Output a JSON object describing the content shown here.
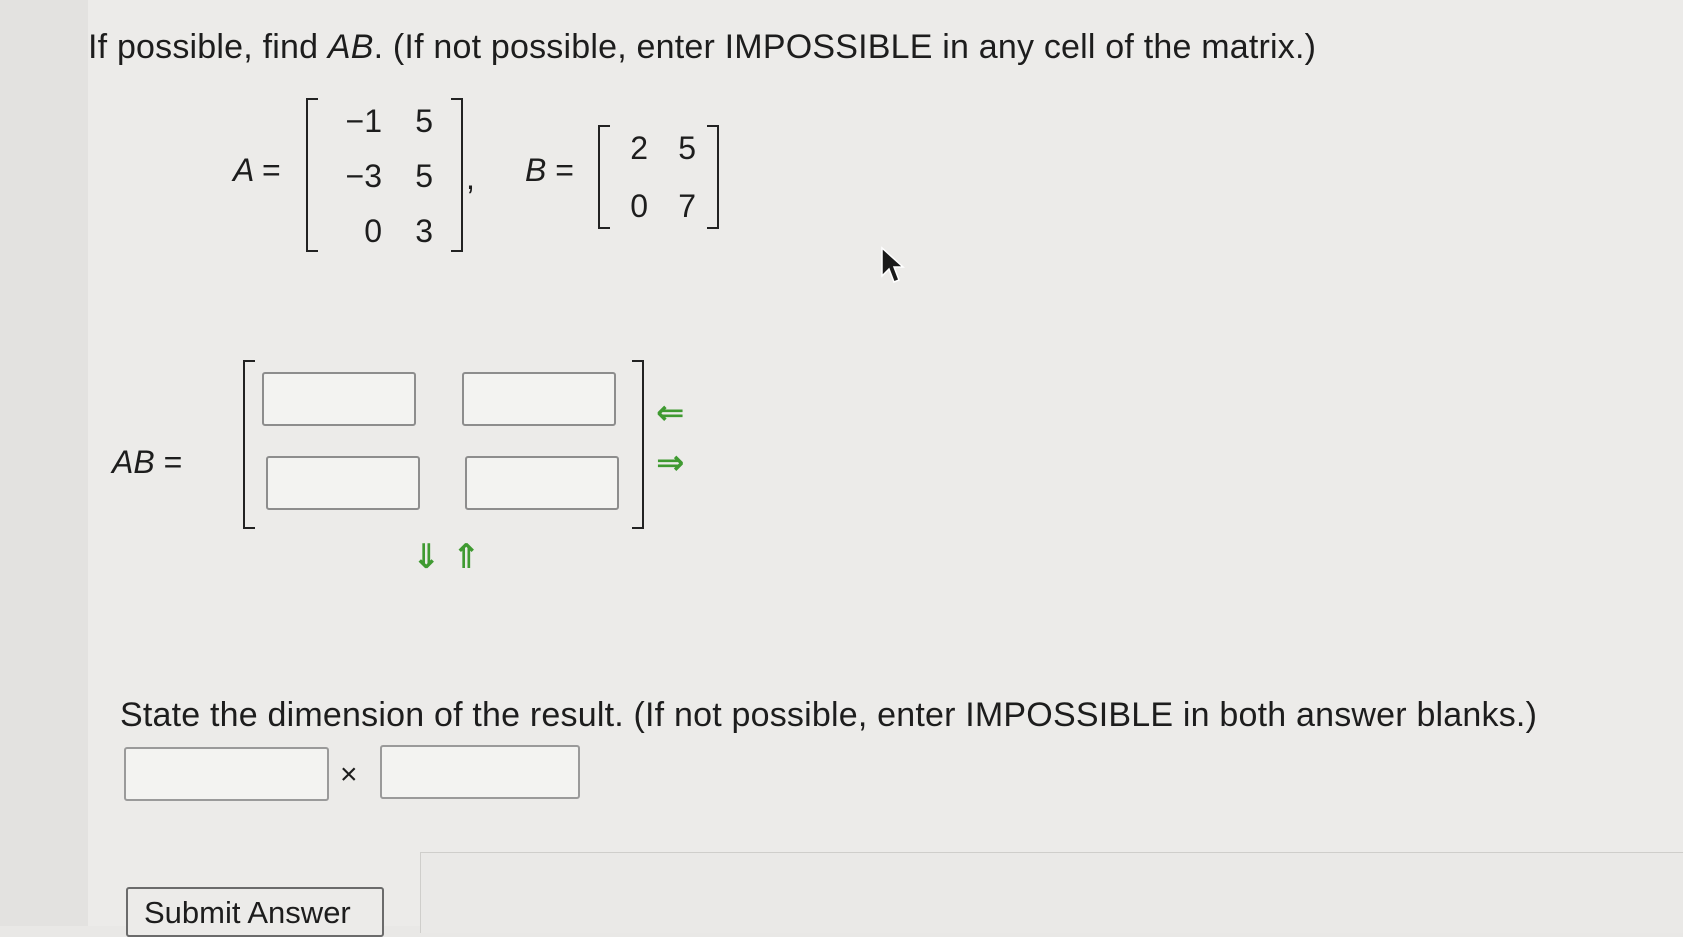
{
  "question": {
    "instruction_prefix": "If possible, find ",
    "instruction_var": "AB",
    "instruction_suffix": ". (If not possible, enter IMPOSSIBLE in any cell of the matrix.)"
  },
  "matrix_a": {
    "label": "A",
    "rows": [
      [
        "−1",
        "5"
      ],
      [
        "−3",
        "5"
      ],
      [
        "0",
        "3"
      ]
    ]
  },
  "separator": ",",
  "matrix_b": {
    "label": "B",
    "rows": [
      [
        "2",
        "5"
      ],
      [
        "0",
        "7"
      ]
    ]
  },
  "answer": {
    "label": "AB",
    "cells": [
      [
        "",
        ""
      ],
      [
        "",
        ""
      ]
    ]
  },
  "dimension": {
    "prompt": "State the dimension of the result. (If not possible, enter IMPOSSIBLE in both answer blanks.)",
    "rows_value": "",
    "cols_value": "",
    "times": "×"
  },
  "controls": {
    "add_column_arrow": "⇐",
    "remove_column_arrow": "⇒",
    "add_row_arrow": "⇓",
    "remove_row_arrow": "⇑",
    "submit_label": "Submit Answer"
  },
  "colors": {
    "arrow": "#3f9a31",
    "background": "#ecebe9"
  }
}
